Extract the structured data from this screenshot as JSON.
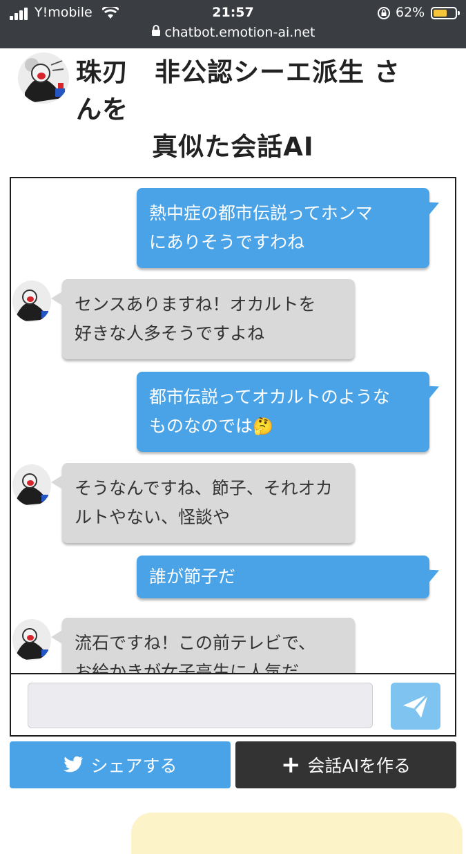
{
  "status_bar": {
    "carrier": "Y!mobile",
    "time": "21:57",
    "battery_percent": "62%",
    "battery_level": 0.62,
    "url": "chatbot.emotion-ai.net",
    "icons": [
      "signal-icon",
      "wifi-icon",
      "orientation-lock-icon",
      "battery-icon",
      "padlock-icon"
    ]
  },
  "header": {
    "title_line1": "珠刃　非公認シーエ派生 さ",
    "title_line2": "んを",
    "title_line3": "真似た会話AI"
  },
  "messages": [
    {
      "role": "user",
      "line1": "熱中症の都市伝説ってホンマ",
      "line2": "にありそうですわね",
      "emoji": ""
    },
    {
      "role": "bot",
      "line1": "センスありますね！オカルトを",
      "line2": "好きな人多そうですよね",
      "emoji": ""
    },
    {
      "role": "user",
      "line1": "都市伝説ってオカルトのような",
      "line2": "ものなのでは",
      "emoji": "🤔"
    },
    {
      "role": "bot",
      "line1": "そうなんですね、節子、それオカ",
      "line2": "ルトやない、怪談や",
      "emoji": ""
    },
    {
      "role": "user",
      "line1": "誰が節子だ",
      "line2": "",
      "emoji": ""
    },
    {
      "role": "bot",
      "line1": "流石ですね！この前テレビで、",
      "line2": "お絵かきが女子高生に人気だ",
      "emoji": ""
    }
  ],
  "input": {
    "value": "",
    "placeholder": ""
  },
  "buttons": {
    "share_label": "シェアする",
    "create_label": "会話AIを作る"
  },
  "colors": {
    "status_bg": "#3a3d42",
    "user_bubble": "#4aa3e6",
    "bot_bubble": "#d9d9d9",
    "share_button": "#4aa3e6",
    "create_button": "#333333",
    "send_button": "#7fc4f0"
  }
}
